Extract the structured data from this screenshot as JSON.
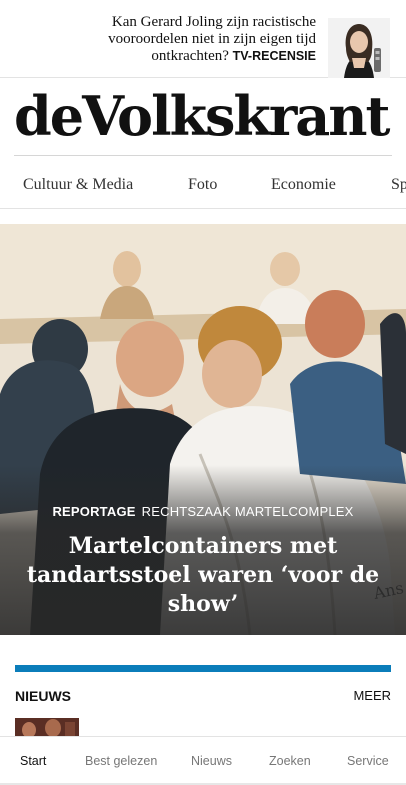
{
  "promo": {
    "line1": "Kan Gerard Joling zijn racistische",
    "line2": "vooroordelen niet in zijn eigen tijd",
    "line3": "ontkrachten?",
    "tag": "TV-RECENSIE",
    "image": "portrait-woman-with-remote"
  },
  "masthead": {
    "logo": "deVolkskrant"
  },
  "nav": {
    "items": [
      "Cultuur & Media",
      "Foto",
      "Economie",
      "Sp"
    ]
  },
  "hero": {
    "image": "courtroom-sketch-illustration",
    "kicker_label": "REPORTAGE",
    "kicker_topic": "RECHTSZAAK MARTELCOMPLEX",
    "title": "Martelcontainers met tandartsstoel waren ‘voor de show’"
  },
  "news": {
    "heading": "NIEUWS",
    "more": "MEER",
    "accent": "#0b7dba"
  },
  "bottom_nav": {
    "items": [
      "Start",
      "Best gelezen",
      "Nieuws",
      "Zoeken",
      "Service"
    ]
  }
}
